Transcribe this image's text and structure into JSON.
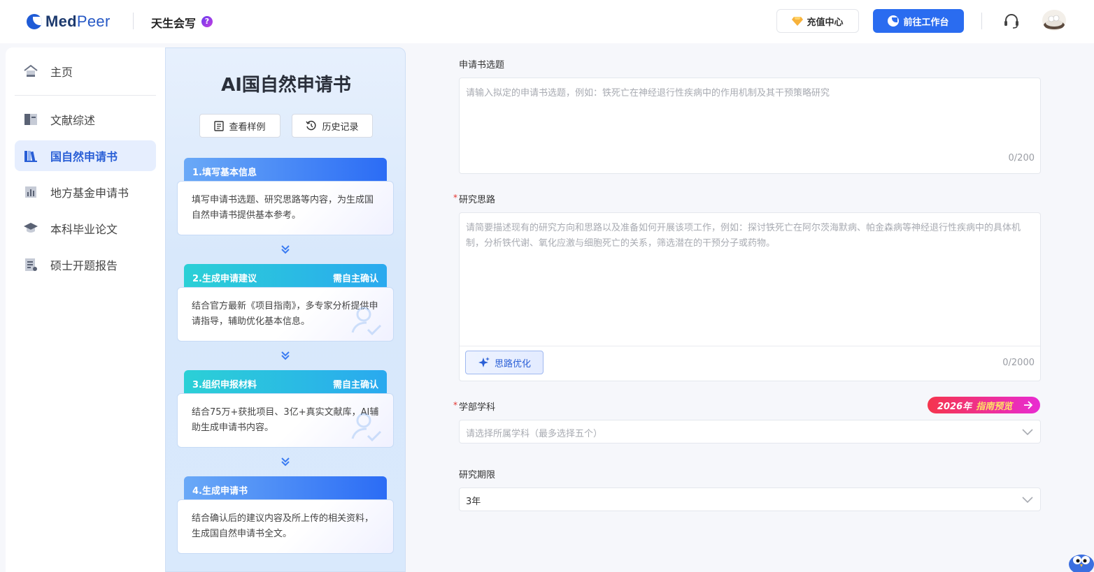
{
  "header": {
    "logo_bold": "Med",
    "logo_thin": "Peer",
    "app_name": "天生会写",
    "help_mark": "?",
    "recharge_label": "充值中心",
    "workbench_label": "前往工作台"
  },
  "sidebar": {
    "items": [
      {
        "label": "主页",
        "icon": "home-icon",
        "active": false
      },
      {
        "label": "文献综述",
        "icon": "book-icon",
        "active": false
      },
      {
        "label": "国自然申请书",
        "icon": "library-icon",
        "active": true
      },
      {
        "label": "地方基金申请书",
        "icon": "bar-chart-icon",
        "active": false
      },
      {
        "label": "本科毕业论文",
        "icon": "graduation-cap-icon",
        "active": false
      },
      {
        "label": "硕士开题报告",
        "icon": "report-icon",
        "active": false
      }
    ]
  },
  "steps_panel": {
    "title": "AI国自然申请书",
    "sample_btn": "查看样例",
    "history_btn": "历史记录",
    "steps": [
      {
        "title": "1.填写基本信息",
        "confirm": "",
        "desc": "填写申请书选题、研究思路等内容，为生成国自然申请书提供基本参考。"
      },
      {
        "title": "2.生成申请建议",
        "confirm": "需自主确认",
        "desc": "结合官方最新《项目指南》，多专家分析提供申请指导，辅助优化基本信息。"
      },
      {
        "title": "3.组织申报材料",
        "confirm": "需自主确认",
        "desc": "结合75万+获批项目、3亿+真实文献库，AI辅助生成申请书内容。"
      },
      {
        "title": "4.生成申请书",
        "confirm": "",
        "desc": "结合确认后的建议内容及所上传的相关资料，生成国自然申请书全文。"
      }
    ]
  },
  "form": {
    "topic": {
      "label": "申请书选题",
      "placeholder": "请输入拟定的申请书选题，例如：铁死亡在神经退行性疾病中的作用机制及其干预策略研究",
      "counter": "0/200"
    },
    "idea": {
      "required_mark": "*",
      "label": "研究思路",
      "placeholder": "请简要描述现有的研究方向和思路以及准备如何开展该项工作，例如：探讨铁死亡在阿尔茨海默病、帕金森病等神经退行性疾病中的具体机制，分析铁代谢、氧化应激与细胞死亡的关系，筛选潜在的干预分子或药物。",
      "optimize_btn": "思路优化",
      "counter": "0/2000"
    },
    "discipline": {
      "required_mark": "*",
      "label": "学部学科",
      "placeholder": "请选择所属学科（最多选择五个）",
      "badge_year": "2026年",
      "badge_text": "指南预览"
    },
    "period": {
      "label": "研究期限",
      "value": "3年"
    }
  },
  "colors": {
    "primary": "#2a6cf0",
    "active_bg": "#e6eefe",
    "required": "#e3342f",
    "badge_start": "#f5354d",
    "badge_end": "#e82bd2"
  }
}
